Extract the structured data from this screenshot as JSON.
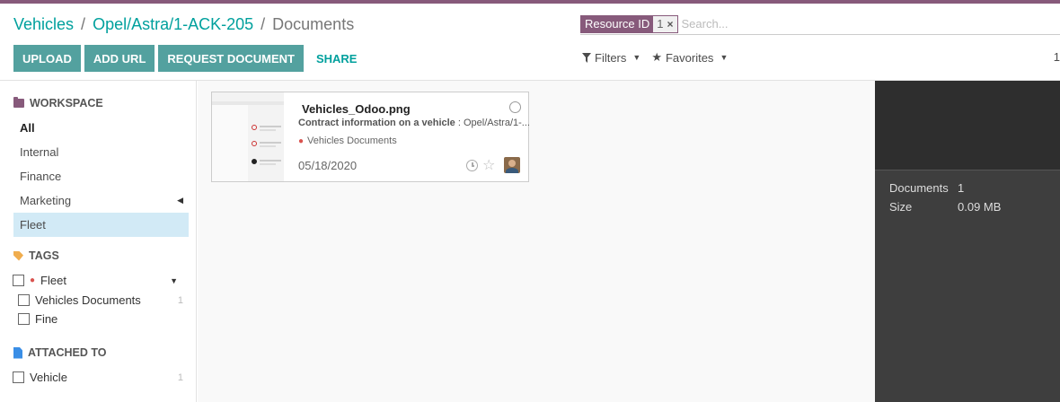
{
  "breadcrumb": {
    "items": [
      "Vehicles",
      "Opel/Astra/1-ACK-205"
    ],
    "separator": "/",
    "current": "Documents"
  },
  "buttons": {
    "upload": "UPLOAD",
    "add_url": "ADD URL",
    "request_document": "REQUEST DOCUMENT",
    "share": "SHARE"
  },
  "search": {
    "facet_label": "Resource ID",
    "facet_value": "1",
    "remove_icon": "×",
    "placeholder": "Search..."
  },
  "search_options": {
    "filters": "Filters",
    "favorites": "Favorites"
  },
  "pager": {
    "text": "1"
  },
  "sidebar": {
    "workspace": {
      "title": "WORKSPACE",
      "items": [
        "All",
        "Internal",
        "Finance",
        "Marketing",
        "Fleet"
      ],
      "active": "Fleet"
    },
    "tags": {
      "title": "TAGS",
      "group": "Fleet",
      "items": [
        {
          "label": "Vehicles Documents",
          "count": "1"
        },
        {
          "label": "Fine",
          "count": ""
        }
      ]
    },
    "attached_to": {
      "title": "ATTACHED TO",
      "items": [
        {
          "label": "Vehicle",
          "count": "1"
        }
      ]
    }
  },
  "card": {
    "name": "Vehicles_Odoo.png",
    "desc_bold": "Contract information on a vehicle",
    "desc_rest": " : Opel/Astra/1-...",
    "tag": "Vehicles Documents",
    "date": "05/18/2020",
    "star": "☆"
  },
  "inspector": {
    "documents_label": "Documents",
    "documents_value": "1",
    "size_label": "Size",
    "size_value": "0.09 MB"
  },
  "colors": {
    "brand": "#875a7b",
    "accent": "#00a09d",
    "button": "#53a19f",
    "active_row": "#d2eaf6",
    "inspector_bg": "#3e3e3e"
  }
}
